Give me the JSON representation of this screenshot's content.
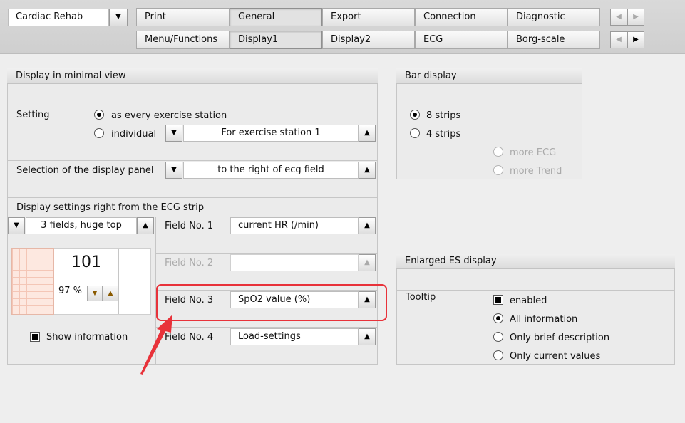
{
  "app": {
    "selector": "Cardiac Rehab"
  },
  "tabs_row1": [
    "Print",
    "General",
    "Export",
    "Connection",
    "Diagnostic"
  ],
  "tabs_row2": [
    "Menu/Functions",
    "Display1",
    "Display2",
    "ECG",
    "Borg-scale"
  ],
  "minimal_view": {
    "title": "Display in minimal view",
    "setting_label": "Setting",
    "option_every": "as every exercise station",
    "option_individual": "individual",
    "station_combo": "For exercise station 1",
    "selection_label": "Selection of the display panel",
    "selection_combo": "to the right of ecg field",
    "right_settings_label": "Display settings right from the ECG strip",
    "fields_combo": "3 fields, huge top",
    "preview_hr": "101",
    "preview_spo2": "97 %",
    "show_info_label": "Show information",
    "fields": [
      {
        "label": "Field No. 1",
        "value": "current HR (/min)"
      },
      {
        "label": "Field No. 2",
        "value": ""
      },
      {
        "label": "Field No. 3",
        "value": "SpO2 value (%)"
      },
      {
        "label": "Field No. 4",
        "value": "Load-settings"
      }
    ]
  },
  "bar_display": {
    "title": "Bar display",
    "options": [
      "8 strips",
      "4 strips",
      "more ECG",
      "more Trend"
    ]
  },
  "enlarged": {
    "title": "Enlarged ES display",
    "tooltip_label": "Tooltip",
    "enabled_label": "enabled",
    "options": [
      "All information",
      "Only brief description",
      "Only current values"
    ]
  },
  "colors": {
    "highlight": "#e8323a"
  }
}
